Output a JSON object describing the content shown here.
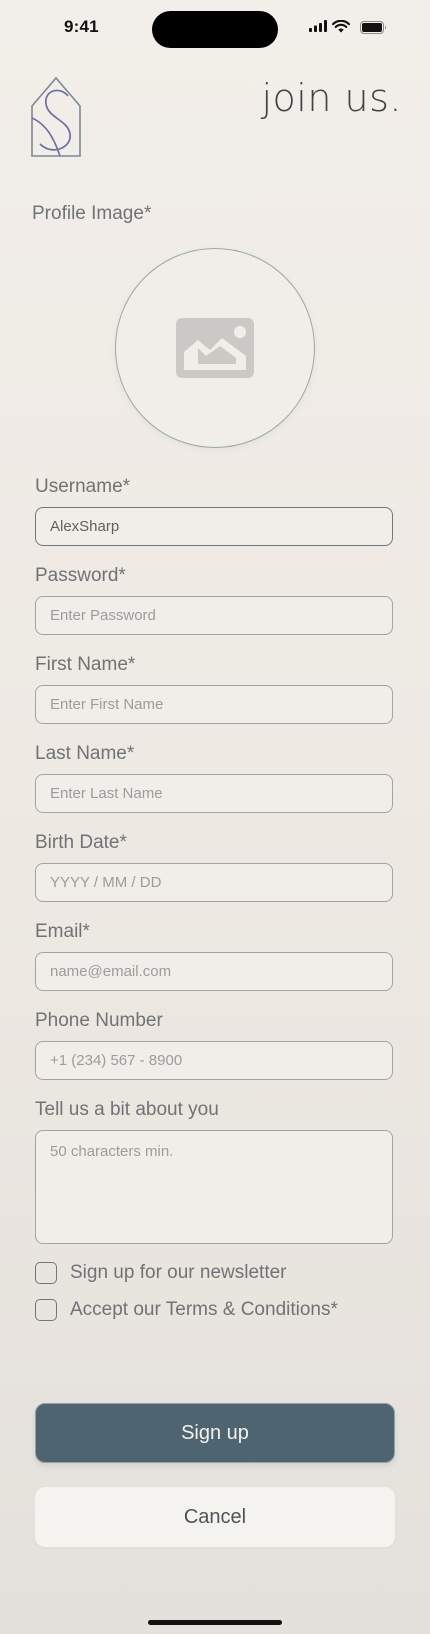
{
  "status_bar": {
    "time": "9:41"
  },
  "header": {
    "title": "join us."
  },
  "profile": {
    "label": "Profile Image*",
    "icon": "image-placeholder-icon"
  },
  "fields": [
    {
      "label": "Username*",
      "value": "AlexSharp",
      "placeholder": ""
    },
    {
      "label": "Password*",
      "value": "",
      "placeholder": "Enter Password"
    },
    {
      "label": "First Name*",
      "value": "",
      "placeholder": "Enter First Name"
    },
    {
      "label": "Last Name*",
      "value": "",
      "placeholder": "Enter Last Name"
    },
    {
      "label": "Birth Date*",
      "value": "",
      "placeholder": "YYYY / MM / DD"
    },
    {
      "label": "Email*",
      "value": "",
      "placeholder": "name@email.com"
    },
    {
      "label": "Phone Number",
      "value": "",
      "placeholder": "+1 (234) 567 - 8900"
    }
  ],
  "about": {
    "label": "Tell us a bit about you",
    "placeholder": "50 characters min."
  },
  "checkboxes": [
    {
      "label": "Sign up for our newsletter",
      "checked": false
    },
    {
      "label": "Accept our Terms & Conditions*",
      "checked": false
    }
  ],
  "buttons": {
    "primary": "Sign up",
    "secondary": "Cancel"
  },
  "colors": {
    "primary_button": "#4e6471",
    "background": "#efebe6",
    "border": "#9ea5a8"
  }
}
